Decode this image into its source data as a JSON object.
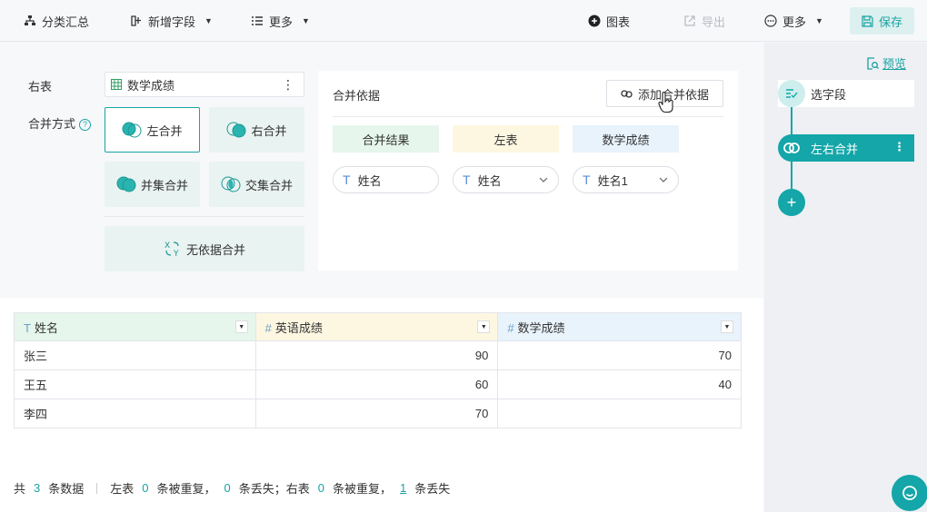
{
  "toolbar": {
    "group_summary": "分类汇总",
    "add_field": "新增字段",
    "more_left": "更多",
    "chart": "图表",
    "export": "导出",
    "more_right": "更多",
    "save": "保存"
  },
  "config": {
    "right_table_label": "右表",
    "right_table_value": "数学成绩",
    "merge_mode_label": "合并方式",
    "modes": {
      "left": "左合并",
      "right": "右合并",
      "union": "并集合并",
      "intersect": "交集合并",
      "no_basis": "无依据合并"
    },
    "basis": {
      "title": "合并依据",
      "add_button": "添加合并依据",
      "col_result": "合并结果",
      "col_left": "左表",
      "col_right": "数学成绩",
      "field_result": "姓名",
      "field_left": "姓名",
      "field_right": "姓名1"
    }
  },
  "sidebar": {
    "preview": "预览",
    "step_select": "选字段",
    "step_merge": "左右合并"
  },
  "grid": {
    "headers": [
      "姓名",
      "英语成绩",
      "数学成绩"
    ],
    "rows": [
      [
        "张三",
        "90",
        "70"
      ],
      [
        "王五",
        "60",
        "40"
      ],
      [
        "李四",
        "70",
        ""
      ]
    ]
  },
  "summary": {
    "prefix": "共",
    "total": "3",
    "total_suffix": "条数据",
    "left_table": "左表",
    "left_dup": "0",
    "dup_text": "条被重复，",
    "left_lost": "0",
    "lost_text_left": "条丢失；右表",
    "right_dup": "0",
    "dup_text_right": "条被重复，",
    "right_lost": "1",
    "lost_text_right": "条丢失"
  },
  "colors": {
    "accent": "#14a6a8",
    "result_bg": "#e6f6ec",
    "left_bg": "#fdf7e1",
    "right_bg": "#e8f3fc"
  }
}
